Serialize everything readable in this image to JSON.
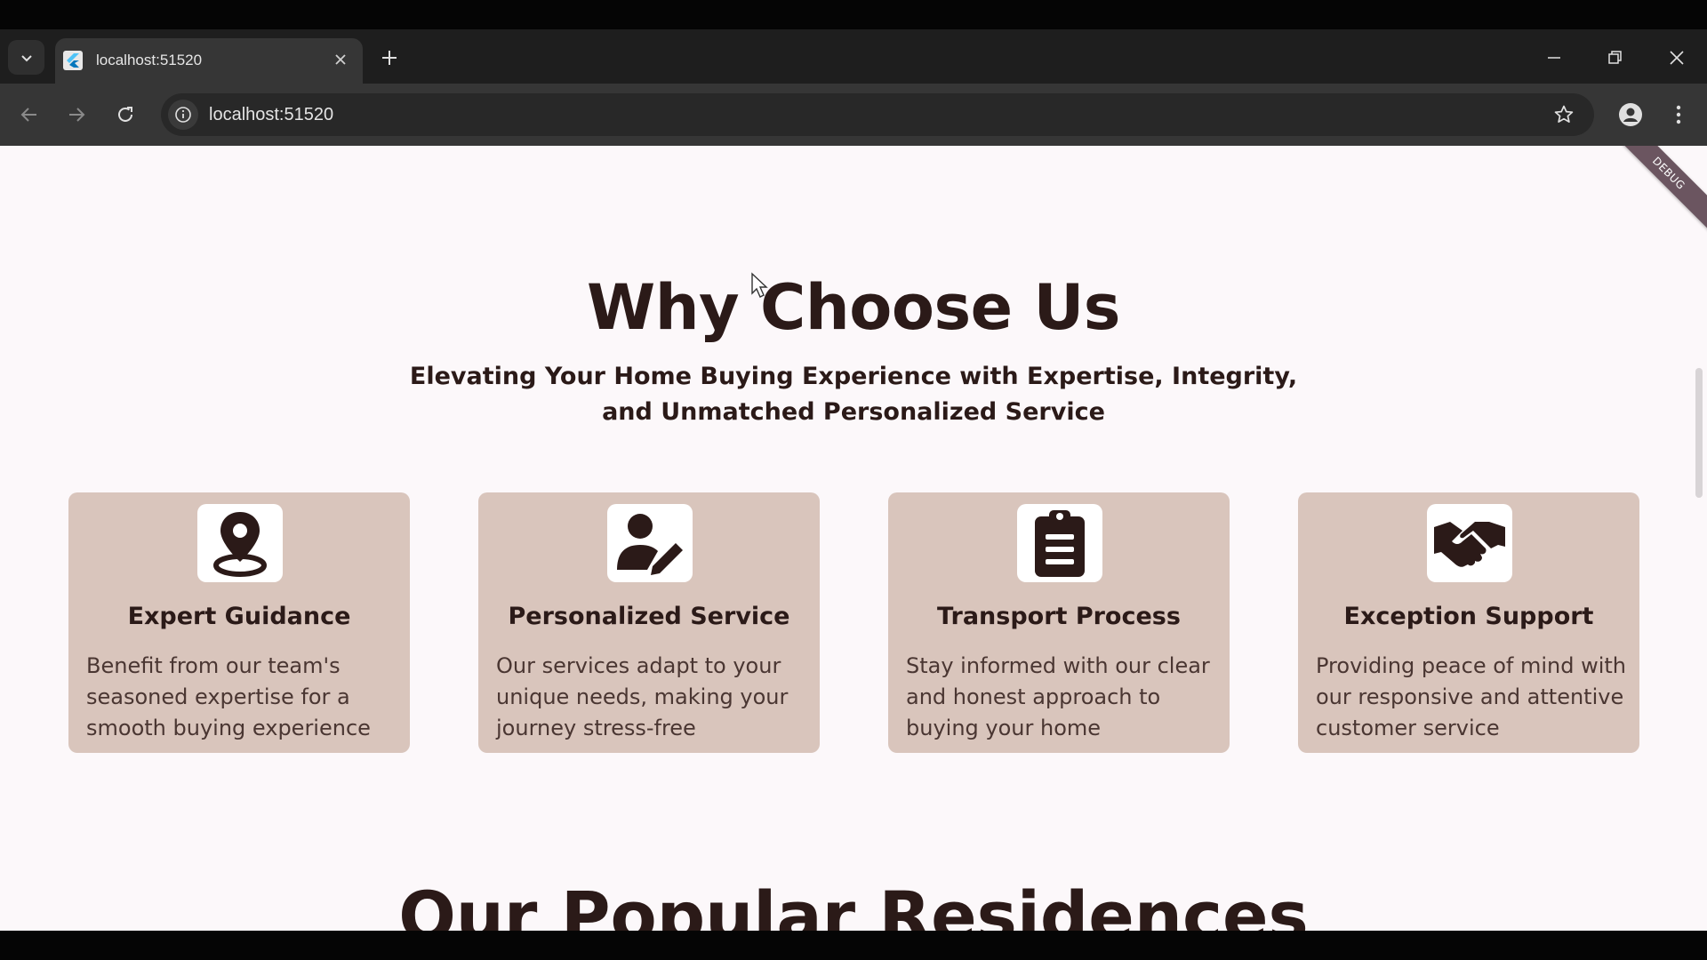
{
  "browser": {
    "tab_title": "localhost:51520",
    "url": "localhost:51520"
  },
  "page": {
    "debug_label": "DEBUG",
    "section_title": "Why Choose Us",
    "section_subtitle_line1": "Elevating Your Home Buying Experience with Expertise, Integrity,",
    "section_subtitle_line2": "and Unmatched Personalized Service",
    "cards": [
      {
        "icon": "location-pin-icon",
        "title": "Expert Guidance",
        "description": "Benefit from our team's seasoned expertise for a smooth buying experience"
      },
      {
        "icon": "person-edit-icon",
        "title": "Personalized Service",
        "description": "Our services adapt to your unique needs, making your journey stress-free"
      },
      {
        "icon": "clipboard-icon",
        "title": "Transport Process",
        "description": "Stay informed with our clear and honest approach to buying your home"
      },
      {
        "icon": "handshake-icon",
        "title": "Exception Support",
        "description": "Providing peace of mind with our responsive and attentive customer service"
      }
    ],
    "next_section_title": "Our Popular Residences"
  }
}
